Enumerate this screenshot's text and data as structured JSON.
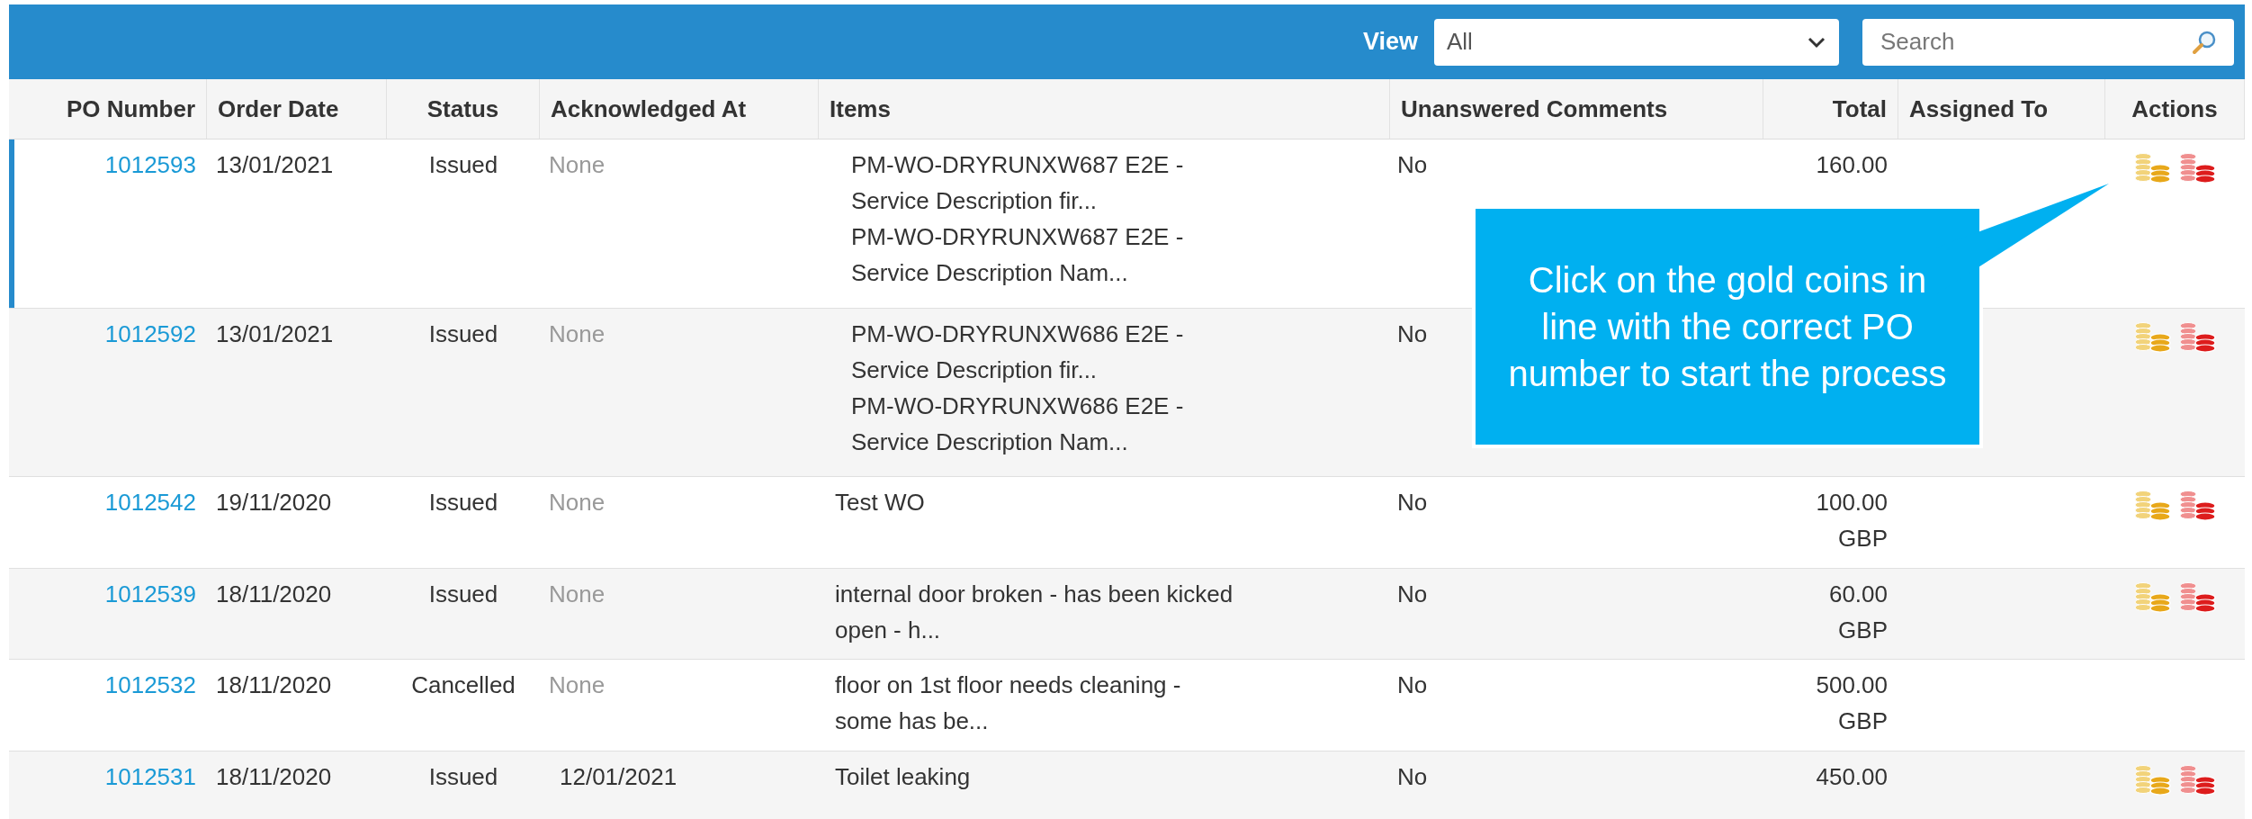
{
  "toolbar": {
    "view_label": "View",
    "view_value": "All",
    "search_placeholder": "Search"
  },
  "table": {
    "columns": [
      "PO Number",
      "Order Date",
      "Status",
      "Acknowledged At",
      "Items",
      "Unanswered Comments",
      "Total",
      "Assigned To",
      "Actions"
    ],
    "rows": [
      {
        "selected": true,
        "po_number": "1012593",
        "order_date": "13/01/2021",
        "status": "Issued",
        "acknowledged_at": "None",
        "acknowledged": false,
        "items": [
          "PM-WO-DRYRUNXW687 E2E -",
          "Service Description fir...",
          "PM-WO-DRYRUNXW687 E2E -",
          "Service Description Nam..."
        ],
        "unanswered_comments": "No",
        "total": [
          "160.00"
        ],
        "actions": true
      },
      {
        "selected": false,
        "po_number": "1012592",
        "order_date": "13/01/2021",
        "status": "Issued",
        "acknowledged_at": "None",
        "acknowledged": false,
        "items": [
          "PM-WO-DRYRUNXW686 E2E -",
          "Service Description fir...",
          "PM-WO-DRYRUNXW686 E2E -",
          "Service Description Nam..."
        ],
        "unanswered_comments": "No",
        "total": [],
        "actions": true
      },
      {
        "selected": false,
        "po_number": "1012542",
        "order_date": "19/11/2020",
        "status": "Issued",
        "acknowledged_at": "None",
        "acknowledged": false,
        "items": [
          "Test WO"
        ],
        "unanswered_comments": "No",
        "total": [
          "100.00",
          "GBP"
        ],
        "actions": true
      },
      {
        "selected": false,
        "po_number": "1012539",
        "order_date": "18/11/2020",
        "status": "Issued",
        "acknowledged_at": "None",
        "acknowledged": false,
        "items": [
          "internal door broken - has been kicked",
          "open - h..."
        ],
        "unanswered_comments": "No",
        "total": [
          "60.00",
          "GBP"
        ],
        "actions": true
      },
      {
        "selected": false,
        "po_number": "1012532",
        "order_date": "18/11/2020",
        "status": "Cancelled",
        "acknowledged_at": "None",
        "acknowledged": false,
        "items": [
          "floor on 1st floor needs cleaning -",
          "some has be..."
        ],
        "unanswered_comments": "No",
        "total": [
          "500.00",
          "GBP"
        ],
        "actions": false
      },
      {
        "selected": false,
        "po_number": "1012531",
        "order_date": "18/11/2020",
        "status": "Issued",
        "acknowledged_at": "12/01/2021",
        "acknowledged": true,
        "items": [
          "Toilet leaking"
        ],
        "unanswered_comments": "No",
        "total": [
          "450.00"
        ],
        "actions": true
      }
    ]
  },
  "callout": {
    "text": "Click on the gold coins in line with the correct PO number to start the process"
  }
}
